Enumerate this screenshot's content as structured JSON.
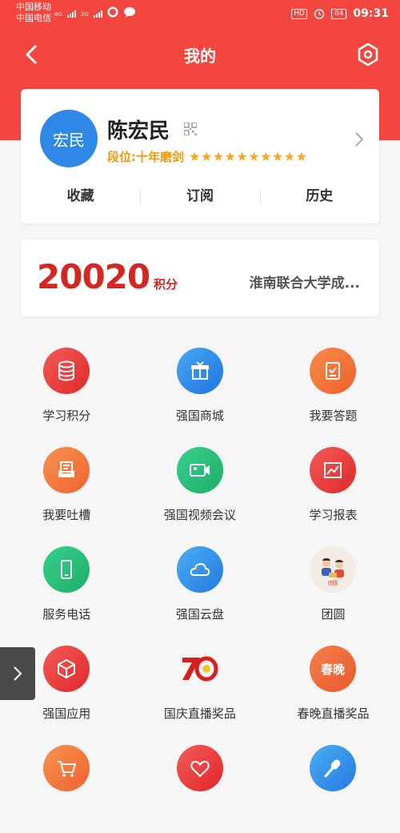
{
  "status_bar": {
    "carrier_1": "中国移动",
    "carrier_2": "中国电信",
    "net_1": "4G",
    "net_2": "2G",
    "hd": "HD",
    "battery": "84",
    "time": "09:31"
  },
  "nav": {
    "title": "我的",
    "back_icon": "chevron-left-icon",
    "settings_icon": "hexagon-settings-icon"
  },
  "profile": {
    "avatar_text": "宏民",
    "name": "陈宏民",
    "rank": "段位:十年磨剑",
    "stars": "★★★★★★★★★★",
    "star_count": 10,
    "tabs": [
      "收藏",
      "订阅",
      "历史"
    ]
  },
  "score": {
    "value": "20020",
    "unit": "积分",
    "organization": "淮南联合大学成..."
  },
  "colors": {
    "brand_red": "#f2463f",
    "score_red": "#d52621",
    "rank_gold": "#e99a14"
  },
  "grid": [
    {
      "label": "学习积分",
      "icon": "database-icon"
    },
    {
      "label": "强国商城",
      "icon": "gift-box-icon"
    },
    {
      "label": "我要答题",
      "icon": "clipboard-check-icon"
    },
    {
      "label": "我要吐槽",
      "icon": "mail-tray-icon"
    },
    {
      "label": "强国视频会议",
      "icon": "video-camera-icon"
    },
    {
      "label": "学习报表",
      "icon": "chart-trend-icon"
    },
    {
      "label": "服务电话",
      "icon": "phone-icon"
    },
    {
      "label": "强国云盘",
      "icon": "cloud-icon"
    },
    {
      "label": "团圆",
      "icon": "reunion-illustration-icon",
      "badge": "团圆"
    },
    {
      "label": "强国应用",
      "icon": "cube-icon"
    },
    {
      "label": "国庆直播奖品",
      "icon": "seventy-anniversary-icon"
    },
    {
      "label": "春晚直播奖品",
      "icon": "spring-gala-icon",
      "badge": "春晚"
    },
    {
      "label": "",
      "icon": "shopping-cart-icon"
    },
    {
      "label": "",
      "icon": "heart-icon"
    },
    {
      "label": "",
      "icon": "microphone-icon"
    }
  ]
}
